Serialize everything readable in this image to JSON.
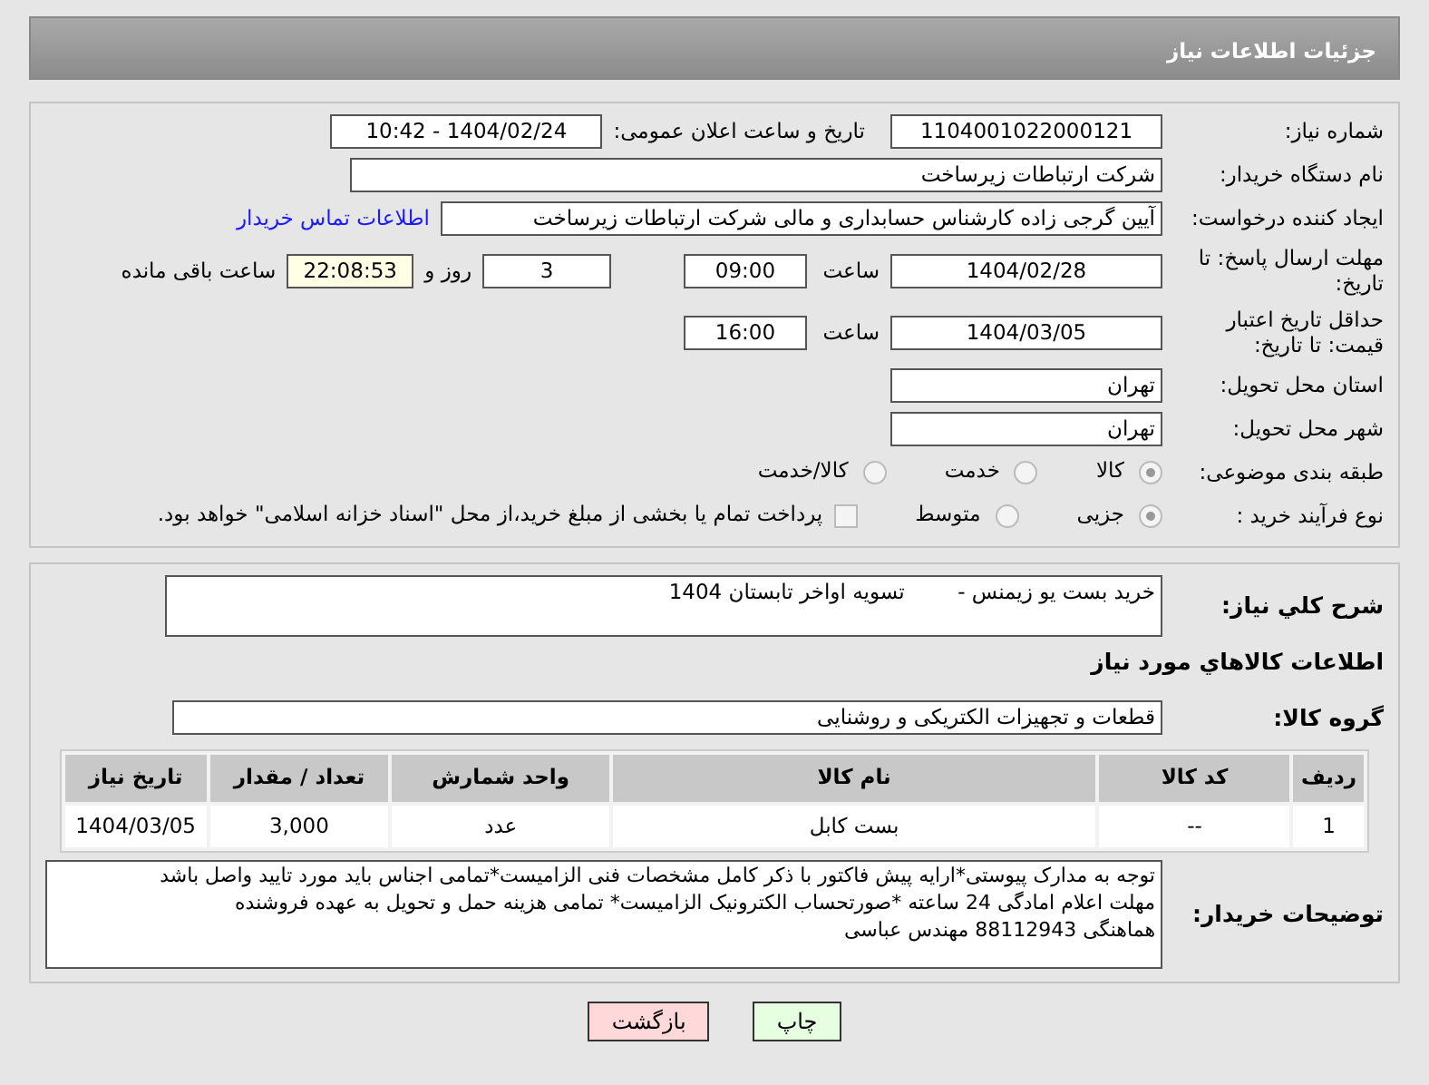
{
  "header": {
    "title": "جزئیات اطلاعات نیاز"
  },
  "need_number": {
    "label": "شماره نیاز:",
    "value": "1104001022000121"
  },
  "announce": {
    "label": "تاریخ و ساعت اعلان عمومی:",
    "value": "1404/02/24 - 10:42"
  },
  "buyer_org": {
    "label": "نام دستگاه خریدار:",
    "value": "شرکت ارتباطات زیرساخت"
  },
  "requester": {
    "label": "ایجاد کننده درخواست:",
    "value": "آیین گرجی زاده کارشناس حسابداری و مالی شرکت ارتباطات زیرساخت",
    "link": "اطلاعات تماس خریدار"
  },
  "deadline": {
    "label": "مهلت ارسال پاسخ: تا تاریخ:",
    "date": "1404/02/28",
    "time_label": "ساعت",
    "time": "09:00",
    "days": "3",
    "days_label": "روز و",
    "remaining": "22:08:53",
    "remaining_label": "ساعت باقی مانده"
  },
  "validity": {
    "label": "حداقل تاریخ اعتبار قیمت: تا تاریخ:",
    "date": "1404/03/05",
    "time_label": "ساعت",
    "time": "16:00"
  },
  "province": {
    "label": "استان محل تحویل:",
    "value": "تهران"
  },
  "city": {
    "label": "شهر محل تحویل:",
    "value": "تهران"
  },
  "category": {
    "label": "طبقه بندی موضوعی:",
    "options": [
      {
        "label": "کالا",
        "selected": true
      },
      {
        "label": "خدمت",
        "selected": false
      },
      {
        "label": "کالا/خدمت",
        "selected": false
      }
    ]
  },
  "process": {
    "label": "نوع فرآیند خرید :",
    "options": [
      {
        "label": "جزیی",
        "selected": true
      },
      {
        "label": "متوسط",
        "selected": false
      }
    ],
    "payment_checkbox": {
      "checked": false,
      "label": "پرداخت تمام یا بخشی از مبلغ خرید،از محل \"اسناد خزانه اسلامی\" خواهد بود."
    }
  },
  "description": {
    "label": "شرح کلي نياز:",
    "value": "خرید بست یو زیمنس -        تسویه اواخر تابستان 1404"
  },
  "goods_title": "اطلاعات کالاهاي مورد نياز",
  "goods_group": {
    "label": "گروه کالا:",
    "value": "قطعات و تجهیزات الکتریکی و روشنایی"
  },
  "table": {
    "columns": [
      "ردیف",
      "کد کالا",
      "نام کالا",
      "واحد شمارش",
      "تعداد / مقدار",
      "تاریخ نیاز"
    ],
    "rows": [
      [
        "1",
        "--",
        "بست کابل",
        "عدد",
        "3,000",
        "1404/03/05"
      ]
    ]
  },
  "buyer_notes": {
    "label": "توضیحات خریدار:",
    "value": "توجه به مدارک پیوستی*ارایه پیش فاکتور با ذکر کامل مشخصات فنی الزامیست*تمامی اجناس باید مورد تایید واصل باشد\nمهلت اعلام امادگی 24 ساعته *صورتحساب الکترونیک الزامیست* تمامی هزینه حمل و تحویل به عهده فروشنده\nهماهنگی 88112943 مهندس عباسی"
  },
  "buttons": [
    {
      "kind": "print",
      "label": "چاپ"
    },
    {
      "kind": "back",
      "label": "بازگشت"
    }
  ]
}
